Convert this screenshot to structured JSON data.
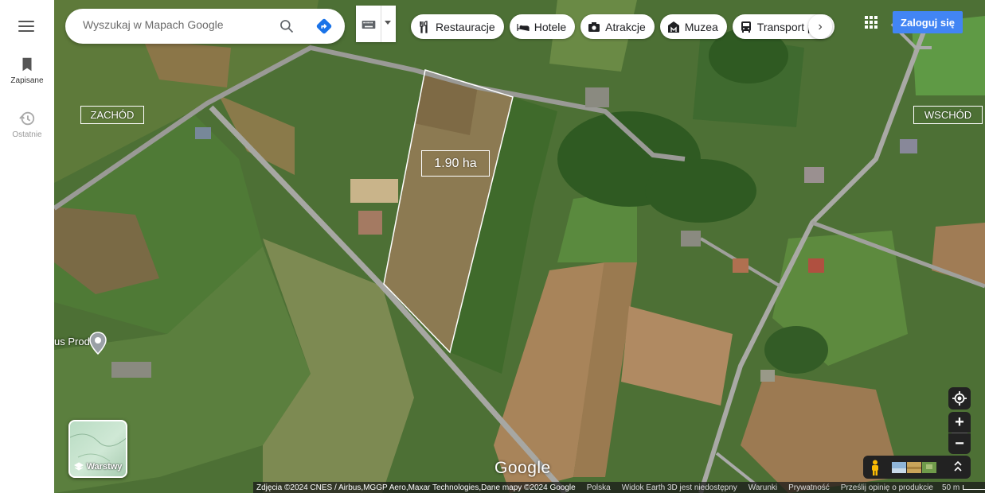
{
  "rail": {
    "saved_label": "Zapisane",
    "recent_label": "Ostatnie"
  },
  "search": {
    "placeholder": "Wyszukaj w Mapach Google"
  },
  "chips": [
    {
      "label": "Restauracje",
      "icon": "fork-knife-icon"
    },
    {
      "label": "Hotele",
      "icon": "bed-icon"
    },
    {
      "label": "Atrakcje",
      "icon": "camera-icon"
    },
    {
      "label": "Muzea",
      "icon": "museum-icon"
    },
    {
      "label": "Transport publ",
      "icon": "bus-icon"
    }
  ],
  "login_label": "Zaloguj się",
  "map_labels": {
    "west": "ZACHÓD",
    "east": "WSCHÓD",
    "area": "1.90 ha",
    "place": "us Prod"
  },
  "layers_label": "Warstwy",
  "google_logo": "Google",
  "footer": {
    "attribution": "Zdjęcia ©2024 CNES / Airbus,MGGP Aero,Maxar Technologies,Dane mapy ©2024 Google",
    "country": "Polska",
    "earth3d": "Widok Earth 3D jest niedostępny",
    "terms": "Warunki",
    "privacy": "Prywatność",
    "feedback": "Prześlij opinię o produkcie",
    "scale": "50 m"
  },
  "colors": {
    "accent": "#4285f4",
    "control_bg": "#222222"
  }
}
